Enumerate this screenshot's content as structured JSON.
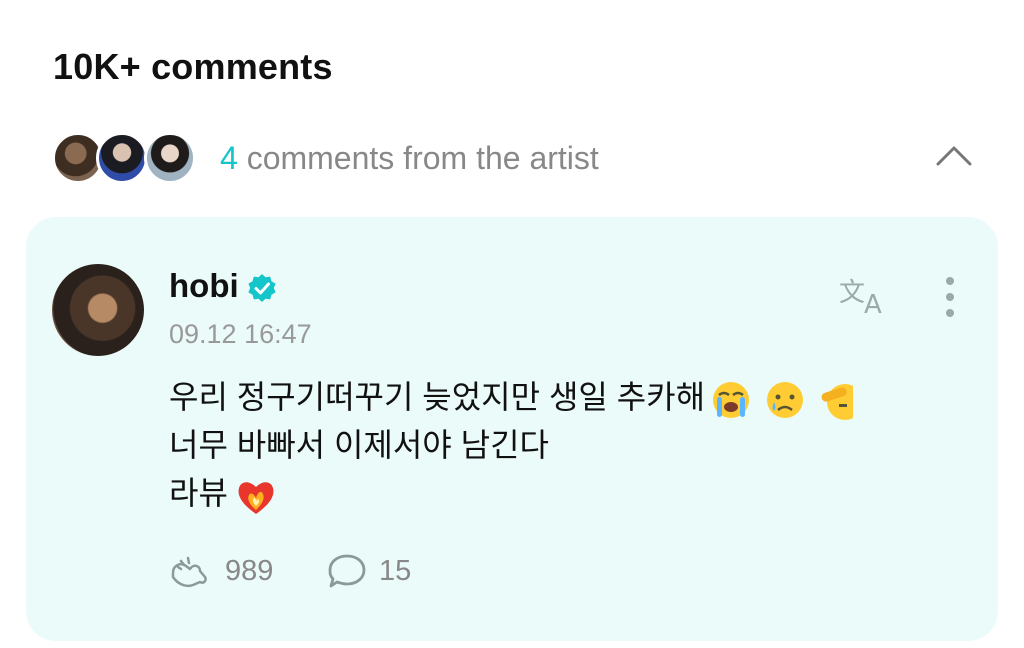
{
  "header": {
    "title": "10K+ comments"
  },
  "artist_comments": {
    "count": "4",
    "label": " comments from the artist",
    "avatars": [
      "artist-avatar-1",
      "artist-avatar-2",
      "artist-avatar-3"
    ],
    "toggle_icon": "chevron-up-icon"
  },
  "comment": {
    "username": "hobi",
    "verified_icon": "verified-badge-icon",
    "timestamp": "09.12 16:47",
    "lines": [
      "우리 정구기떠꾸기 늦었지만 생일 추카해",
      "너무 바빠서 이제서야 남긴다",
      "라뷰"
    ],
    "line1_emojis": [
      "loudly-crying-face-emoji",
      "crying-face-emoji",
      "saluting-face-emoji"
    ],
    "line3_emoji": "heart-on-fire-emoji",
    "likes": "989",
    "replies": "15",
    "accent_color": "#14c5c9",
    "card_color": "#ebfbf9"
  }
}
